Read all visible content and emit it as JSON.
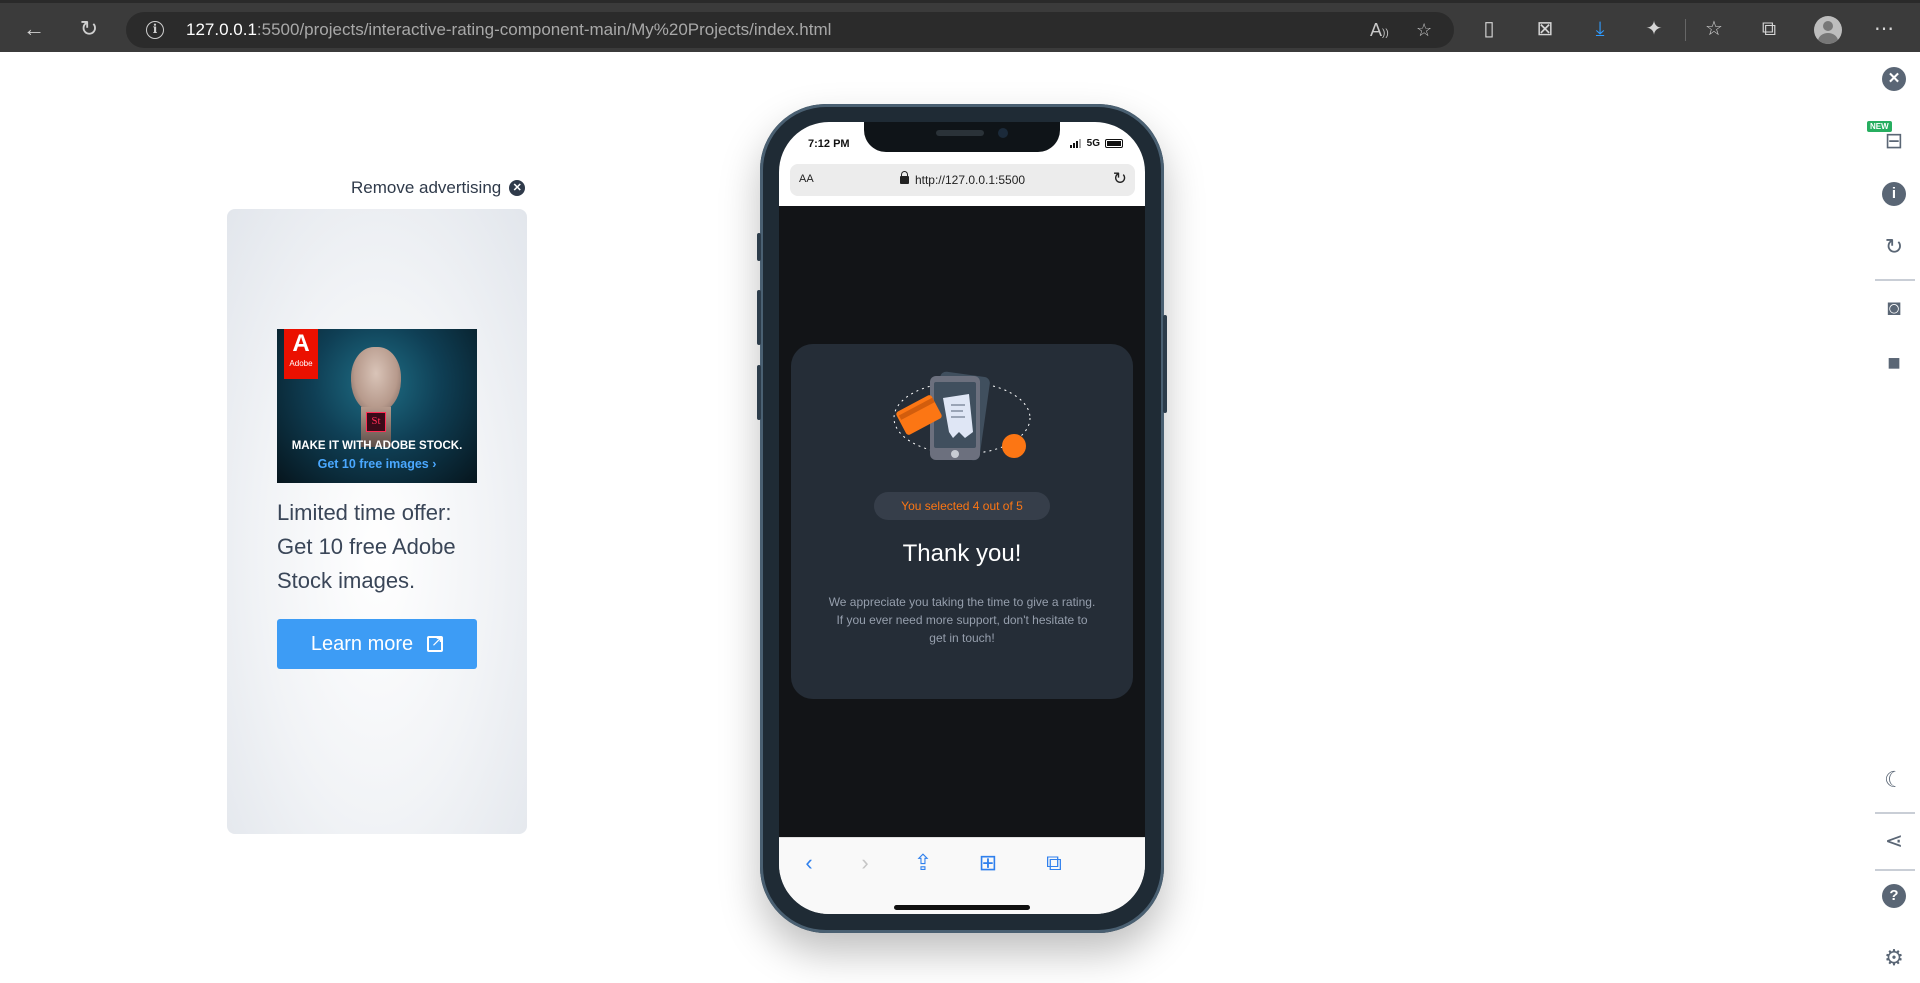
{
  "browser": {
    "url_host": "127.0.0.1",
    "url_path": ":5500/projects/interactive-rating-component-main/My%20Projects/index.html",
    "read_aloud_label": "A"
  },
  "ad": {
    "remove_label": "Remove advertising",
    "brand": "Adobe",
    "brand_letter": "A",
    "product_badge": "St",
    "headline": "MAKE IT WITH ADOBE STOCK.",
    "subline": "Get 10 free images ›",
    "body": "Limited time offer: Get 10 free Adobe Stock images.",
    "button_label": "Learn more"
  },
  "phone": {
    "status_time": "7:12 PM",
    "network": "5G",
    "text_size_label": "AA",
    "url": "http://127.0.0.1:5500",
    "rating": {
      "selected": 4,
      "max": 5,
      "selected_label": "You selected 4 out of 5",
      "title": "Thank you!",
      "message": "We appreciate you taking the time to give a rating. If you ever need more support, don't hesitate to get in touch!"
    },
    "toolbar": [
      "back-icon",
      "forward-icon",
      "share-icon",
      "bookmarks-icon",
      "tabs-icon"
    ]
  },
  "sidebar": {
    "new_badge": "NEW",
    "icons": [
      "close-icon",
      "device-icon",
      "info-icon",
      "rotate-icon",
      "camera-icon",
      "video-icon",
      "moon-icon",
      "share-icon",
      "help-icon",
      "settings-icon"
    ]
  },
  "colors": {
    "accent_orange": "#fc7614",
    "card_bg": "#252d37",
    "page_bg": "#121417",
    "ad_button": "#3d9cf5"
  }
}
